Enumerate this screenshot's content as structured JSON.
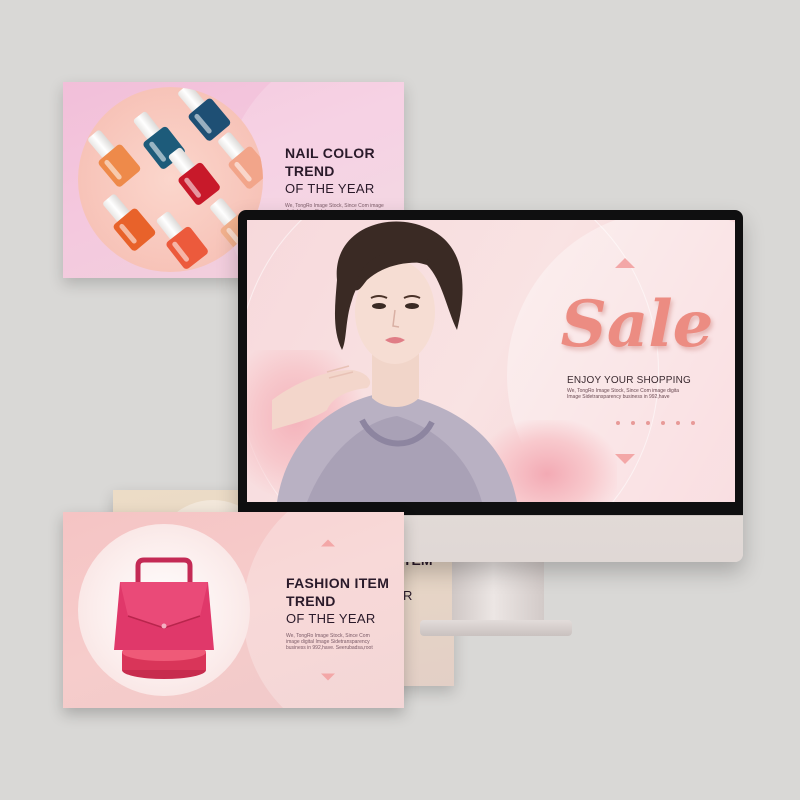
{
  "nail_banner": {
    "title_line1": "NAIL COLOR",
    "title_line2": "TREND",
    "subtitle": "OF THE YEAR",
    "fine_print": "We, TongRo Image Stock, Since Com image digital Image Sidetransparency business in 992,have",
    "bottles": [
      {
        "color": "#1d5b7a"
      },
      {
        "color": "#c8192a"
      },
      {
        "color": "#e8622a"
      },
      {
        "color": "#ec5a3c"
      },
      {
        "color": "#1e4f74"
      },
      {
        "color": "#e87a3a"
      }
    ]
  },
  "monitor_screen": {
    "sale_title": "Sale",
    "sale_subtitle": "ENJOY YOUR SHOPPING",
    "fine_line1": "We, TongRo Image Stock, Since Com image digita",
    "fine_line2": "Image Sidetransparency business in 992,have",
    "dots_count": 6
  },
  "back_banner": {
    "partial_title_line1": "TEM",
    "partial_title_line2": "R"
  },
  "fashion_banner": {
    "title_line1": "FASHION ITEM",
    "title_line2": "TREND",
    "subtitle": "OF THE YEAR",
    "fine_line1": "We, TongRo Image Stock, Since Com",
    "fine_line2": "image digital Image Sidetransparency",
    "fine_line3": "business in 992,have. Seerubadsa,root"
  },
  "colors": {
    "background": "#d9d8d6",
    "accent_pink": "#ec8c82",
    "bag": "#e0386a"
  }
}
